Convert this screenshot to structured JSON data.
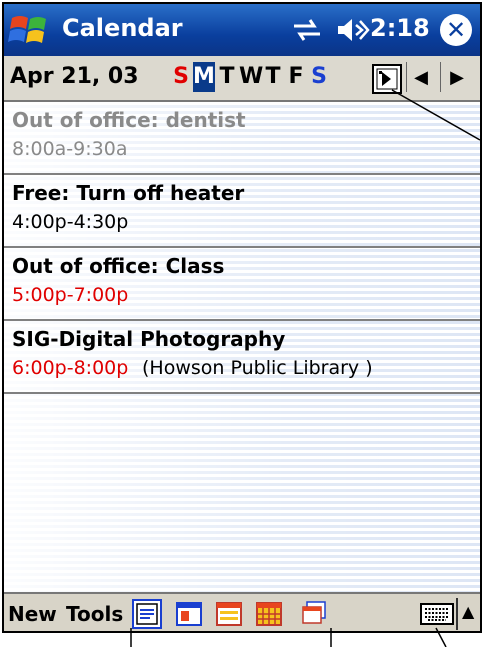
{
  "window": {
    "title": "Calendar",
    "time": "2:18",
    "close_label": "✕"
  },
  "datebar": {
    "date": "Apr 21, 03",
    "days": [
      "S",
      "M",
      "T",
      "W",
      "T",
      "F",
      "S"
    ],
    "selected_day_index": 1,
    "prev_label": "◀",
    "next_label": "▶"
  },
  "appointments": [
    {
      "title": "Out of office: dentist",
      "time": "8:00a-9:30a",
      "location": ""
    },
    {
      "title": "Free: Turn off heater",
      "time": "4:00p-4:30p",
      "location": ""
    },
    {
      "title": "Out of office: Class",
      "time": "5:00p-7:00p",
      "location": ""
    },
    {
      "title": "SIG-Digital Photography",
      "time": "6:00p-8:00p",
      "location": "(Howson Public Library )"
    }
  ],
  "bottom": {
    "new_label": "New",
    "tools_label": "Tools",
    "kbd_arrow": "▲"
  },
  "colors": {
    "titlebar": "#0a3f9e",
    "conflict_time": "#e00000",
    "selected_day": "#0a3a8a",
    "sunday": "#e00000",
    "saturday": "#1a3fd0"
  }
}
